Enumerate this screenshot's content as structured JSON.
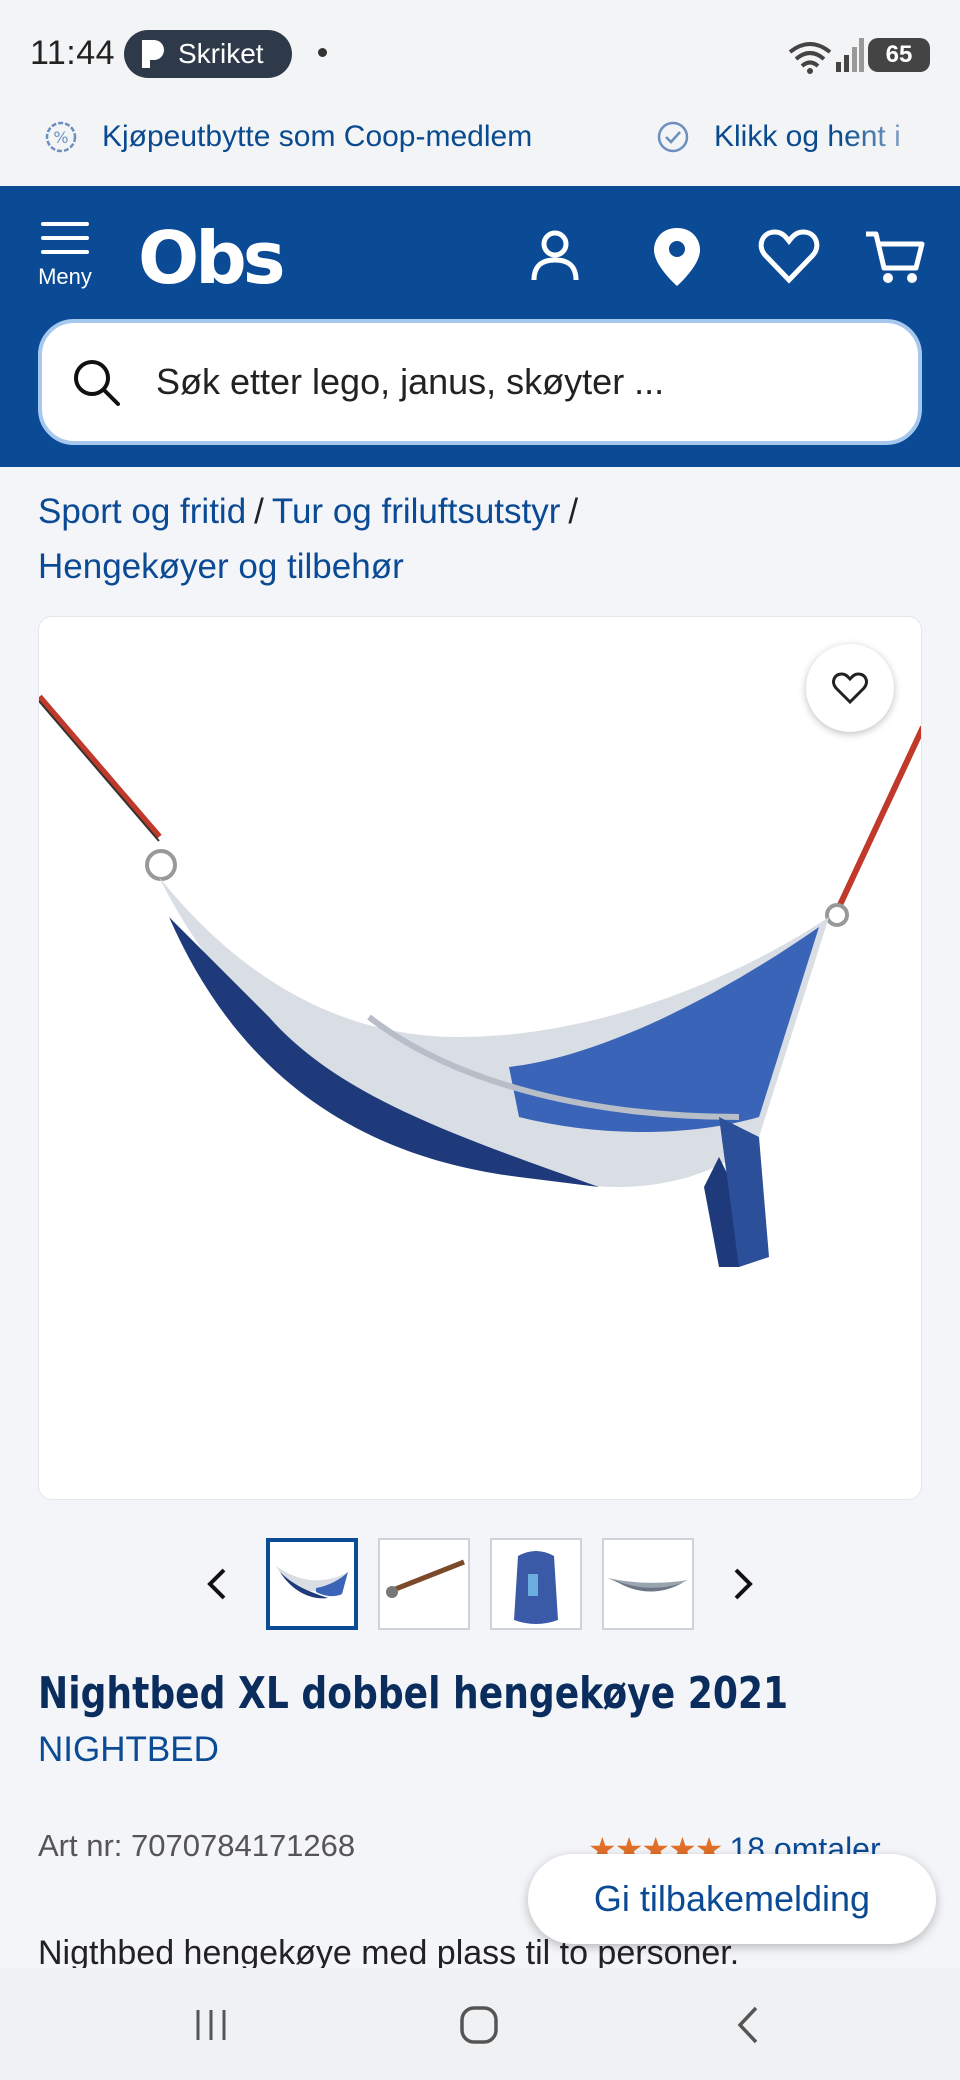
{
  "status_bar": {
    "time": "11:44",
    "app_pill_label": "Skriket",
    "battery": "65"
  },
  "usp": {
    "items": [
      {
        "label": "Kjøpeutbytte som Coop-medlem",
        "icon": "percent-badge-icon"
      },
      {
        "label": "Klikk og hent i",
        "icon": "check-circle-icon"
      }
    ]
  },
  "header": {
    "menu_label": "Meny",
    "logo_text": "Obs",
    "brand_color": "#0b4a94",
    "icons": [
      "account-icon",
      "location-pin-icon",
      "heart-icon",
      "cart-icon"
    ]
  },
  "search": {
    "placeholder": "Søk etter lego, janus, skøyter ..."
  },
  "breadcrumb": {
    "items": [
      "Sport og fritid",
      "Tur og friluftsutstyr",
      "Hengekøyer og tilbehør"
    ],
    "separator": "/"
  },
  "product": {
    "title": "Nightbed XL dobbel hengekøye 2021",
    "brand": "NIGHTBED",
    "art_nr": "Art nr: 7070784171268",
    "rating_stars": 5,
    "reviews": "18 omtaler",
    "description": "Nigthbed hengekøye med plass til to personer."
  },
  "gallery": {
    "thumbnail_count": 4,
    "active_index": 0
  },
  "feedback_button": "Gi tilbakemelding",
  "accent_rating_color": "#e0702a"
}
